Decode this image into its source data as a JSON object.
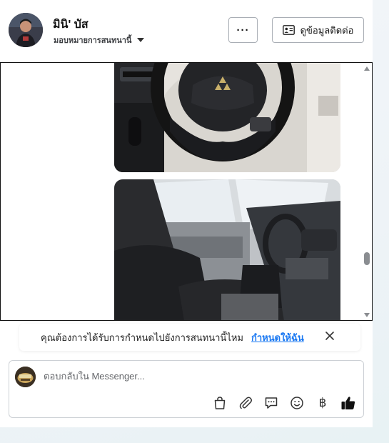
{
  "header": {
    "name": "มินิ' บัส",
    "assign_label": "มอบหมายการสนทนานี้",
    "more_label": "···",
    "contact_label": "ดูข้อมูลติดต่อ"
  },
  "prompt": {
    "text": "คุณต้องการได้รับการกำหนดไปยังการสนทนานี้ไหม",
    "link": "กำหนดให้ฉัน"
  },
  "reply": {
    "placeholder": "ตอบกลับใน Messenger..."
  },
  "reply_tools": {
    "baht_symbol": "฿"
  },
  "colors": {
    "accent": "#1877f2",
    "thumb_icon": "#111111"
  }
}
